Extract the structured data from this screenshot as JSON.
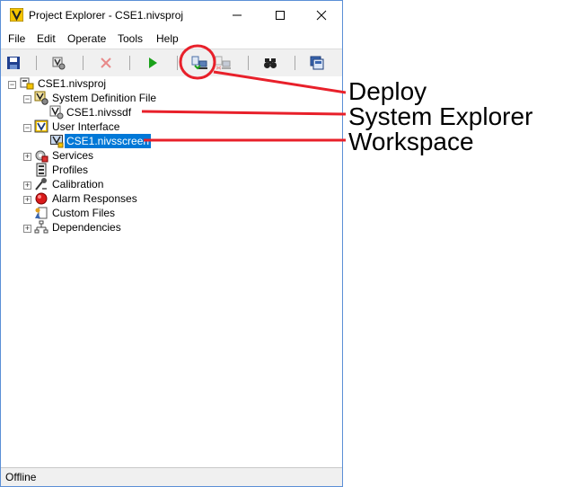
{
  "window": {
    "title": "Project Explorer - CSE1.nivsproj",
    "app_icon": "labview-v-icon",
    "controls": [
      "minimize-icon",
      "maximize-icon",
      "close-icon"
    ]
  },
  "menu": [
    "File",
    "Edit",
    "Operate",
    "Tools",
    "Help"
  ],
  "toolbar": {
    "icons": [
      "save-icon",
      "settings-icon",
      "delete-icon",
      "run-icon",
      "deploy-icon",
      "undeploy-icon",
      "find-icon",
      "workspace-icon"
    ]
  },
  "tree": {
    "root": "CSE1.nivsproj",
    "items": [
      "System Definition File",
      "CSE1.nivssdf",
      "User Interface",
      "CSE1.nivsscreen",
      "Services",
      "Profiles",
      "Calibration",
      "Alarm Responses",
      "Custom Files",
      "Dependencies"
    ]
  },
  "status": "Offline",
  "annotations": {
    "deploy": "Deploy",
    "system_explorer": "System Explorer",
    "workspace": "Workspace",
    "color": "#e8202a"
  }
}
